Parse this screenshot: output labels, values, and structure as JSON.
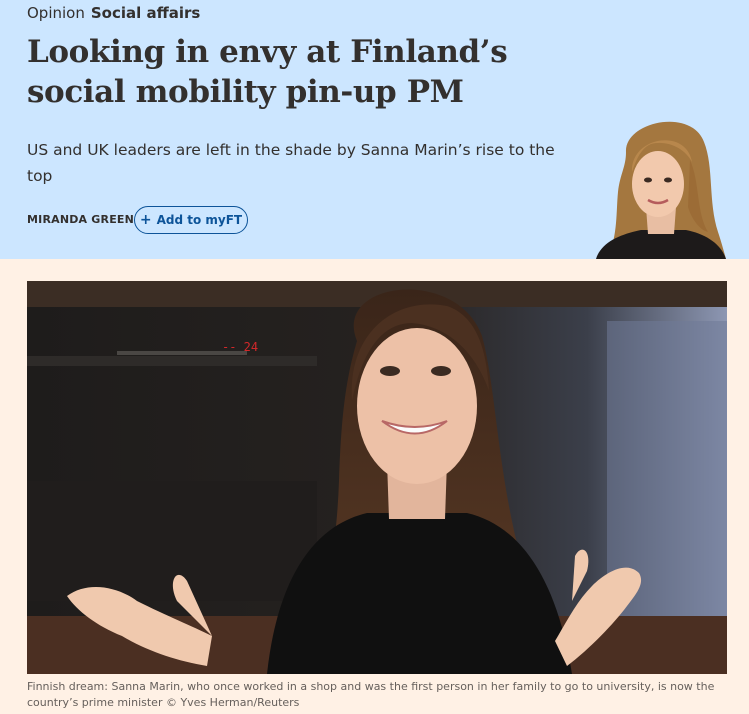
{
  "header": {
    "opinion_label": "Opinion",
    "section_label": "Social affairs",
    "headline": "Looking in envy at Finland’s social mobility pin-up PM",
    "standfirst": "US and UK leaders are left in the shade by Sanna Marin’s rise to the top",
    "author": "MIRANDA GREEN",
    "myft_button": "Add to myFT",
    "myft_icon": "plus-icon",
    "background_color": "#cce6ff",
    "accent_color": "#0d5499"
  },
  "image": {
    "caption": "Finnish dream: Sanna Marin, who once worked in a shop and was the first person in her family to go to university, is now the country’s prime minister © Yves Herman/Reuters",
    "display_readout": "-- 24"
  },
  "page": {
    "background_color": "#fff1e5"
  }
}
